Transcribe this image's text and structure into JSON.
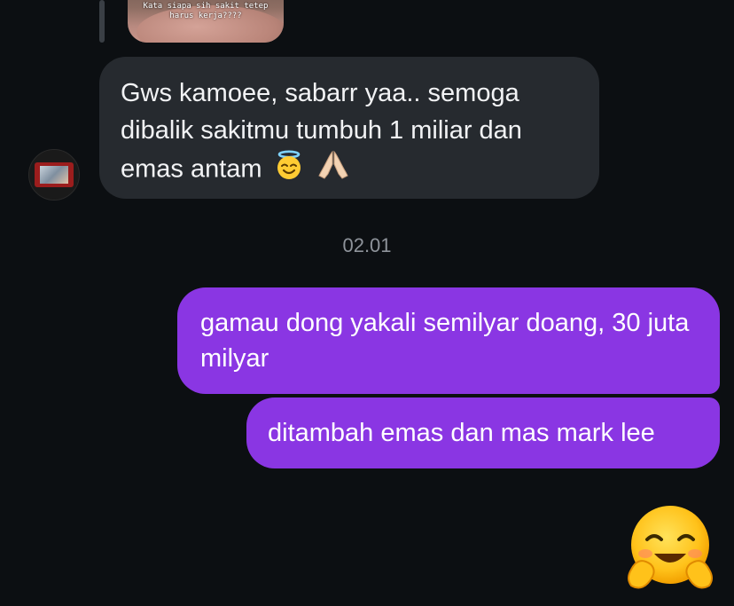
{
  "story_reply": {
    "caption": "Kata siapa sih sakit tetep\nharus kerja????"
  },
  "messages": {
    "incoming": {
      "text": "Gws kamoee, sabarr yaa.. semoga dibalik sakitmu tumbuh 1 miliar dan emas antam",
      "emojis": [
        "smiling-face-with-halo-icon",
        "folded-hands-icon"
      ]
    },
    "timestamp": "02.01",
    "outgoing": [
      {
        "text": "gamau dong yakali semilyar doang, 30 juta milyar"
      },
      {
        "text": "ditambah emas dan mas mark lee"
      }
    ],
    "reaction_emoji": "hugging-face-icon"
  },
  "colors": {
    "background": "#0c0f12",
    "incoming_bubble": "#262a2f",
    "outgoing_bubble": "#8a36e3",
    "timestamp_text": "#8e939a"
  }
}
